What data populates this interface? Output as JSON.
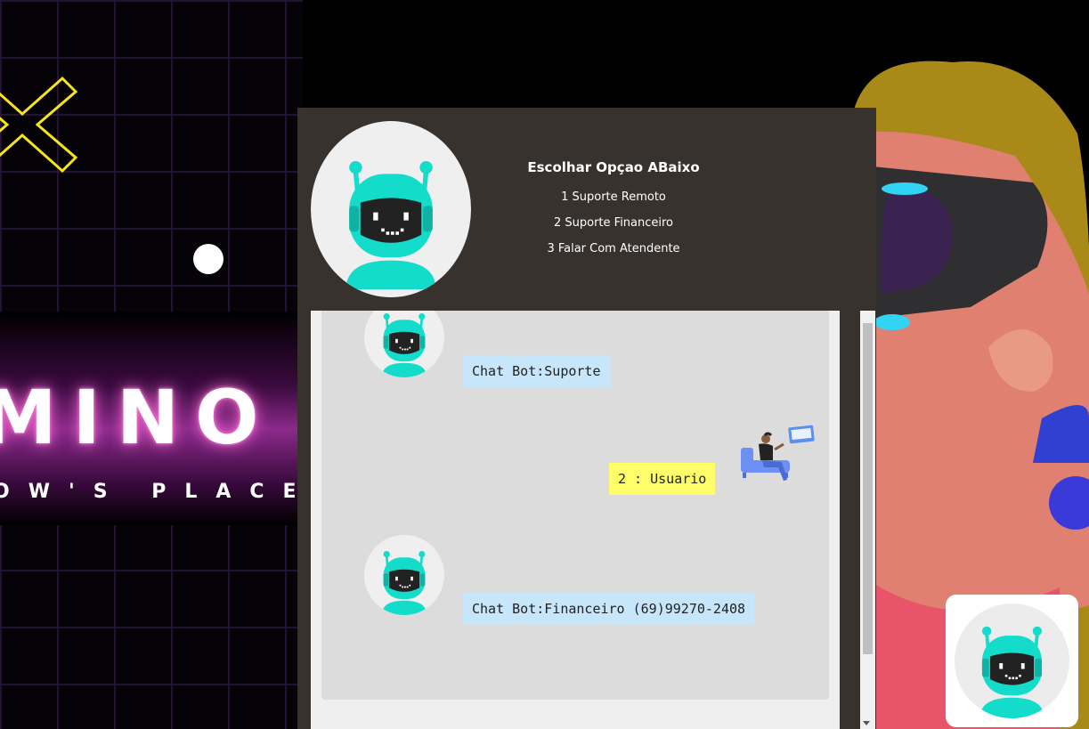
{
  "background": {
    "big_word": "MINO",
    "small_word": "OW'S PLACE"
  },
  "chat": {
    "header": {
      "title": "Escolhar Opçao ABaixo",
      "options": [
        "1 Suporte Remoto",
        "2 Suporte Financeiro",
        "3 Falar Com Atendente"
      ]
    },
    "messages": [
      {
        "from": "bot",
        "text": "Chat Bot:Suporte"
      },
      {
        "from": "user",
        "text": "2 : Usuario"
      },
      {
        "from": "bot",
        "text": "Chat Bot:Financeiro (69)99270-2408"
      }
    ]
  },
  "colors": {
    "window_bg": "#38322e",
    "bot_bubble": "#c7e6fa",
    "user_bubble": "#fffd6a",
    "robot_teal": "#13dcca"
  },
  "icons": {
    "bot_avatar": "robot-icon",
    "user_avatar": "person-on-sofa-illustration",
    "launcher": "robot-icon"
  }
}
